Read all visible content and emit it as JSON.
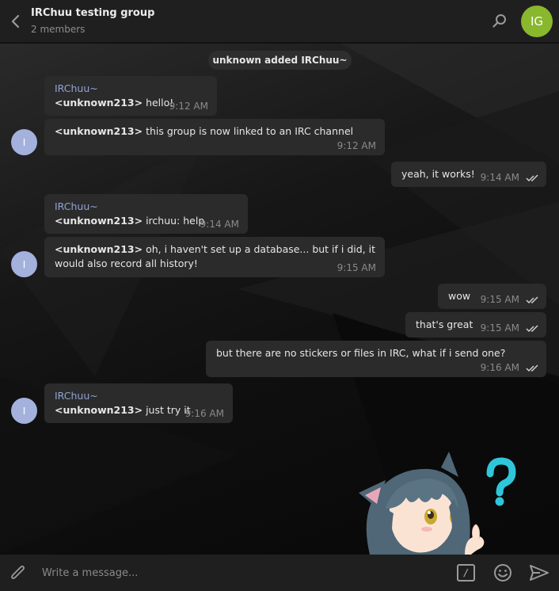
{
  "header": {
    "title": "IRChuu testing group",
    "subtitle": "2 members",
    "avatar_initials": "IG",
    "avatar_color": "#89b72e",
    "icons": {
      "back": "chevron-left-icon",
      "search": "search-icon"
    }
  },
  "service_message": "unknown added IRChuu~",
  "messages": [
    {
      "sender": "IRChuu~",
      "nick": "<unknown213>",
      "text": " hello!",
      "time": "9:12 AM"
    },
    {
      "nick": "<unknown213>",
      "text": " this group is now linked to an IRC channel",
      "time": "9:12 AM",
      "avatar": "I"
    },
    {
      "text": "yeah, it works!",
      "time": "9:14 AM"
    },
    {
      "sender": "IRChuu~",
      "nick": "<unknown213>",
      "text": " irchuu: help",
      "time": "9:14 AM"
    },
    {
      "nick": "<unknown213>",
      "text_line1": " oh, i haven't set up a database... but if i did, it",
      "text_line2": "would also record all history!",
      "time": "9:15 AM",
      "avatar": "I"
    },
    {
      "text": "wow",
      "time": "9:15 AM"
    },
    {
      "text": "that's great",
      "time": "9:15 AM"
    },
    {
      "text": "but there are no stickers or files in IRC, what if i send one?",
      "time": "9:16 AM"
    },
    {
      "sender": "IRChuu~",
      "nick": "<unknown213>",
      "text": " just try it",
      "time": "9:16 AM",
      "avatar": "I"
    }
  ],
  "avatar_color": "#a4b1dd",
  "sender_color": "#8fa4d4",
  "composer": {
    "placeholder": "Write a message...",
    "command_label": "/",
    "icons": {
      "attach": "paperclip-icon",
      "emoji": "emoji-icon",
      "send": "send-icon"
    }
  }
}
